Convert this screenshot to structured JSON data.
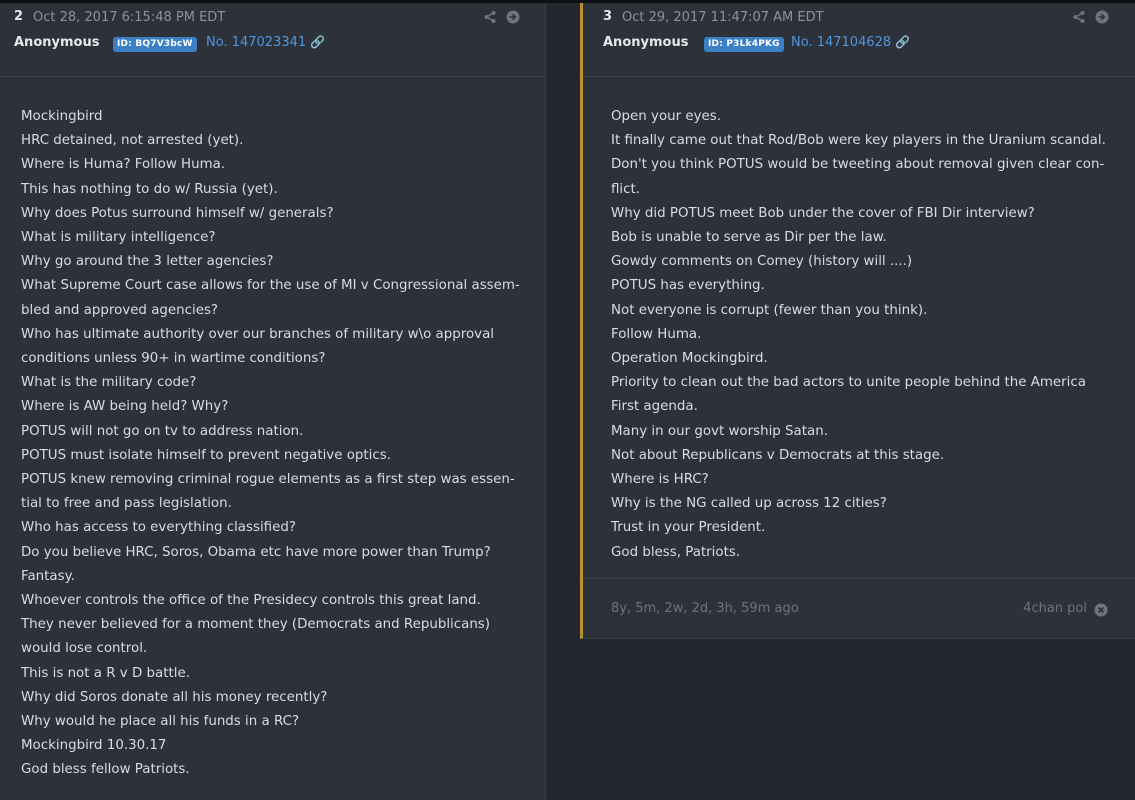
{
  "posts": [
    {
      "number": "2",
      "date": "Oct 28, 2017 6:15:48 PM EDT",
      "author": "Anonymous",
      "id_badge": "ID: BQ7V3bcW",
      "post_no": "No. 147023341",
      "icons": [
        "share-icon",
        "arrow-circle-right-icon",
        "link-icon"
      ],
      "body": "Mockingbird\nHRC detained, not arrested (yet).\nWhere is Huma? Follow Huma.\nThis has nothing to do w/ Russia (yet).\nWhy does Potus surround himself w/ generals?\nWhat is military intelligence?\nWhy go around the 3 letter agencies?\nWhat Supreme Court case allows for the use of MI v Congressional assem-\nbled and approved agencies?\nWho has ultimate authority over our branches of military w\\o approval\nconditions unless 90+ in wartime conditions?\nWhat is the military code?\nWhere is AW being held? Why?\nPOTUS will not go on tv to address nation.\nPOTUS must isolate himself to prevent negative optics.\nPOTUS knew removing criminal rogue elements as a first step was essen-\ntial to free and pass legislation.\nWho has access to everything classified?\nDo you believe HRC, Soros, Obama etc have more power than Trump?\nFantasy.\nWhoever controls the office of the Presidecy controls this great land.\nThey never believed for a moment they (Democrats and Republicans)\nwould lose control.\nThis is not a R v D battle.\nWhy did Soros donate all his money recently?\nWhy would he place all his funds in a RC?\nMockingbird 10.30.17\nGod bless fellow Patriots."
    },
    {
      "number": "3",
      "date": "Oct 29, 2017 11:47:07 AM EDT",
      "author": "Anonymous",
      "id_badge": "ID: P3Lk4PKG",
      "post_no": "No. 147104628",
      "icons": [
        "share-icon",
        "arrow-circle-right-icon",
        "link-icon",
        "close-circle-icon"
      ],
      "body": "Open your eyes.\nIt finally came out that Rod/Bob were key players in the Uranium scandal.\nDon't you think POTUS would be tweeting about removal given clear con-\nflict.\nWhy did POTUS meet Bob under the cover of FBI Dir interview?\nBob is unable to serve as Dir per the law.\nGowdy comments on Comey (history will ....)\nPOTUS has everything.\nNot everyone is corrupt (fewer than you think).\nFollow Huma.\nOperation Mockingbird.\nPriority to clean out the bad actors to unite people behind the America\nFirst agenda.\nMany in our govt worship Satan.\nNot about Republicans v Democrats at this stage.\nWhere is HRC?\nWhy is the NG called up across 12 cities?\nTrust in your President.\nGod bless, Patriots.",
      "age": "8y, 5m, 2w, 2d, 3h, 59m ago",
      "source": "4chan pol"
    }
  ],
  "colors": {
    "background": "#23272d",
    "card": "#2d323a",
    "link": "#4f95df",
    "badge": "#3b7fc4",
    "accent_border": "#b8922e"
  }
}
